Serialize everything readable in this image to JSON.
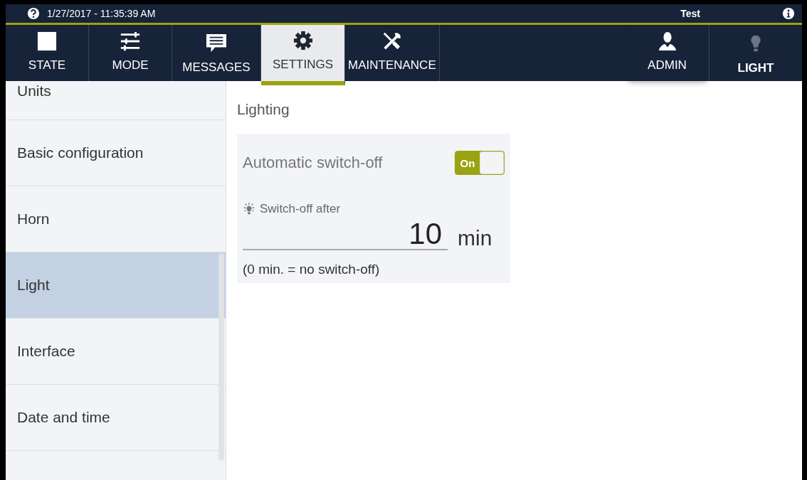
{
  "status_bar": {
    "datetime": "1/27/2017 - 11:35:39 AM",
    "user": "Test"
  },
  "nav": [
    {
      "kind": "state",
      "label": "STATE",
      "selected": false
    },
    {
      "kind": "mode",
      "label": "MODE",
      "selected": false
    },
    {
      "kind": "messages",
      "label": "MESSAGES",
      "selected": false
    },
    {
      "kind": "settings",
      "label": "SETTINGS",
      "selected": true
    },
    {
      "kind": "maintenance",
      "label": "MAINTENANCE",
      "selected": false
    }
  ],
  "nav_right": [
    {
      "kind": "admin",
      "label": "ADMIN"
    },
    {
      "kind": "light",
      "label": "LIGHT"
    }
  ],
  "sidebar": {
    "items": [
      {
        "label": "Units",
        "selected": false
      },
      {
        "label": "Basic configuration",
        "selected": false
      },
      {
        "label": "Horn",
        "selected": false
      },
      {
        "label": "Light",
        "selected": true
      },
      {
        "label": "Interface",
        "selected": false
      },
      {
        "label": "Date and time",
        "selected": false
      }
    ]
  },
  "panel": {
    "title": "Lighting",
    "toggle_label": "Automatic switch-off",
    "toggle": {
      "on": true,
      "text": "On"
    },
    "field_label": "Switch-off after",
    "value": "10",
    "unit": "min",
    "hint": "(0 min. = no switch-off)"
  }
}
